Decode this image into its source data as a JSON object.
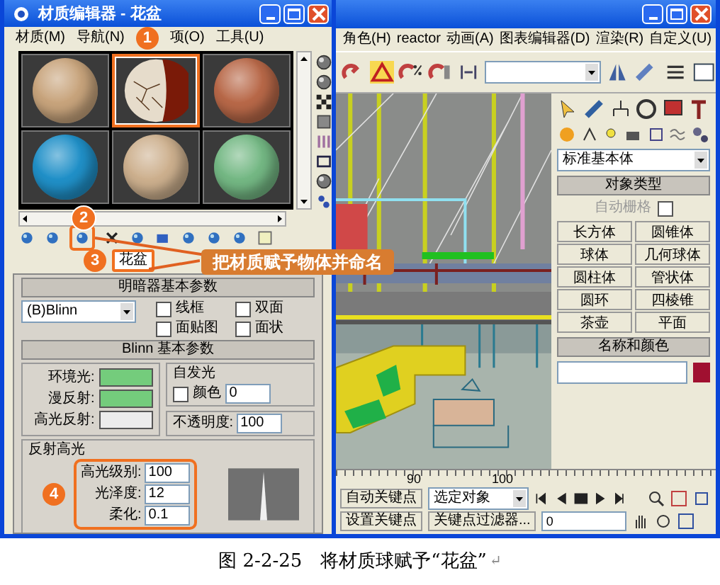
{
  "main_window": {
    "menu": [
      "角色(H)",
      "reactor",
      "动画(A)",
      "图表编辑器(D)",
      "渲染(R)",
      "自定义(U)"
    ],
    "command_panel": {
      "category": "标准基本体",
      "object_type": {
        "title": "对象类型",
        "autogrid": {
          "label": "自动栅格",
          "checked": false,
          "disabled": true
        },
        "buttons": [
          "长方体",
          "圆锥体",
          "球体",
          "几何球体",
          "圆柱体",
          "管状体",
          "圆环",
          "四棱锥",
          "茶壶",
          "平面"
        ]
      },
      "name_color": {
        "title": "名称和颜色",
        "color": "#a01030"
      }
    },
    "timeline": {
      "ticks": [
        "90",
        "100"
      ]
    },
    "controls": {
      "auto_key": "自动关键点",
      "selection": "选定对象",
      "set_key": "设置关键点",
      "key_filters": "关键点过滤器...",
      "frame": "0"
    }
  },
  "material_editor": {
    "title": "材质编辑器 - 花盆",
    "menu": [
      "材质(M)",
      "导航(N)",
      "项(O)",
      "工具(U)"
    ],
    "samples": [
      {
        "kind": "plain",
        "color": "#c8a47c",
        "selected": false
      },
      {
        "kind": "cracked",
        "color": "#e6dccb",
        "selected": true
      },
      {
        "kind": "plain",
        "color": "#b86848",
        "selected": false
      },
      {
        "kind": "plain",
        "color": "#2090c8",
        "selected": false
      },
      {
        "kind": "plain",
        "color": "#cdb08e",
        "selected": false
      },
      {
        "kind": "plain",
        "color": "#74b884",
        "selected": false
      }
    ],
    "name_field": {
      "value": "花盆"
    },
    "shader_rollout": {
      "title": "明暗器基本参数",
      "shader": "(B)Blinn",
      "options": [
        {
          "label": "线框",
          "checked": false
        },
        {
          "label": "双面",
          "checked": false
        },
        {
          "label": "面贴图",
          "checked": false
        },
        {
          "label": "面状",
          "checked": false
        }
      ]
    },
    "blinn_rollout": {
      "title": "Blinn 基本参数",
      "colors": [
        {
          "label": "环境光:",
          "color": "#74cc7c"
        },
        {
          "label": "漫反射:",
          "color": "#74cc7c"
        },
        {
          "label": "高光反射:",
          "color": "#ececec"
        }
      ],
      "self_illum": {
        "title": "自发光",
        "label": "颜色",
        "checked": false,
        "value": "0"
      },
      "opacity": {
        "label": "不透明度:",
        "value": "100"
      },
      "specular": {
        "title": "反射高光",
        "fields": [
          {
            "label": "高光级别:",
            "value": "100"
          },
          {
            "label": "光泽度:",
            "value": "12"
          },
          {
            "label": "柔化:",
            "value": "0.1"
          }
        ]
      }
    }
  },
  "callouts": {
    "badges": [
      "1",
      "2",
      "3",
      "4"
    ],
    "label": "把材质赋予物体并命名"
  },
  "caption": {
    "text": "图 2-2-25　将材质球赋予“花盆”",
    "mark": "↵"
  }
}
